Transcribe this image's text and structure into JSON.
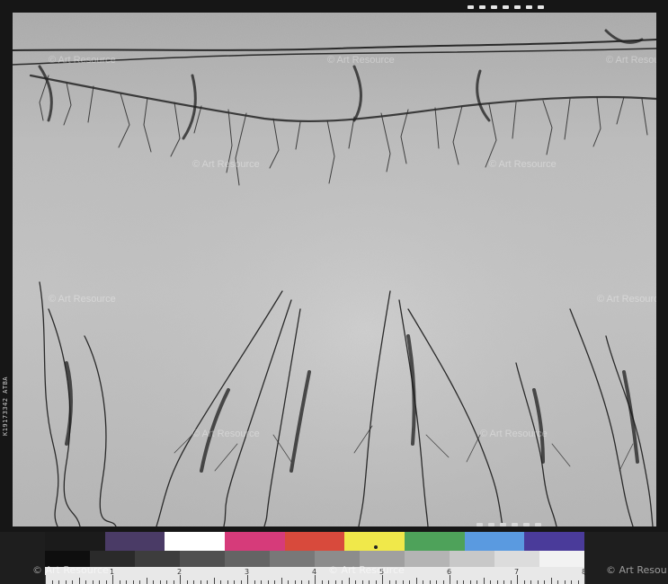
{
  "film_edge_code": "K19173342 ATBA",
  "watermark": "© Art Resource",
  "watermark_truncated": "© Art Resou",
  "color_patches": [
    "#1b1b1b",
    "#4a3b66",
    "#ffffff",
    "#d63b7a",
    "#d84a3c",
    "#f0e84a",
    "#4ea25a",
    "#5a9ae0",
    "#4a3b9a"
  ],
  "gray_patches": [
    "#0e0e0e",
    "#2a2a2a",
    "#3d3d3d",
    "#505050",
    "#646464",
    "#787878",
    "#8c8c8c",
    "#a0a0a0",
    "#b4b4b4",
    "#c8c8c8",
    "#dcdcdc",
    "#f2f2f2"
  ],
  "ruler_numbers": [
    "1",
    "2",
    "3",
    "4",
    "5",
    "6",
    "7",
    "8"
  ]
}
